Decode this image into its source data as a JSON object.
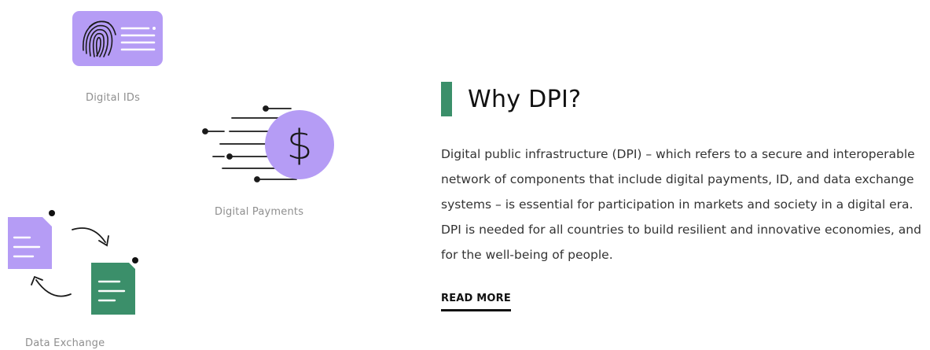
{
  "illustrations": {
    "digital_ids": {
      "caption": "Digital IDs",
      "icon": "fingerprint-card-icon"
    },
    "digital_payments": {
      "caption": "Digital Payments",
      "icon": "dollar-coin-icon",
      "symbol": "$"
    },
    "data_exchange": {
      "caption": "Data Exchange",
      "icon": "document-exchange-icon"
    }
  },
  "section": {
    "title": "Why DPI?",
    "body": "Digital public infrastructure (DPI) – which refers to a secure and interoperable network of components that include digital payments, ID, and data exchange systems – is essential for participation in markets and society in a digital era. DPI is needed for all countries to build resilient and innovative economies, and for the well-being of people.",
    "read_more_label": "READ MORE"
  },
  "colors": {
    "accent_green": "#3b8f6a",
    "accent_purple": "#b59cf5",
    "text_dark": "#111111",
    "caption_gray": "#8f8f8f"
  }
}
